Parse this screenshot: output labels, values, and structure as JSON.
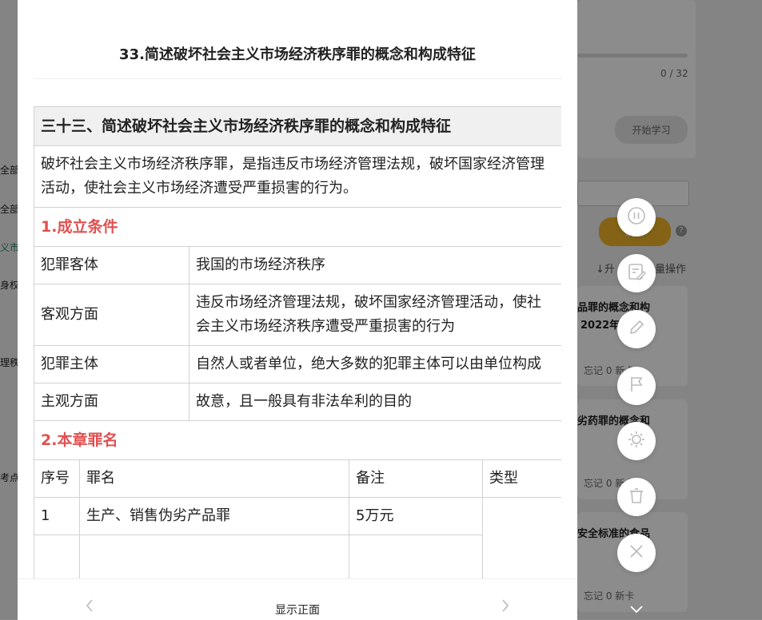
{
  "background": {
    "progress_count": "0 / 32",
    "start_button": "开始学习",
    "action_button": "刷新",
    "sort_hint": "升",
    "batch_label": "批量操作",
    "left_labels": [
      "全部",
      "全部",
      "义市",
      "身权",
      "理秩",
      "考点"
    ],
    "cards": [
      {
        "title": "品罪的概念和构",
        "subtitle": "2022年",
        "stats": "忘记 0  新卡"
      },
      {
        "title": "劣药罪的概念和",
        "stats": "忘记 0  新卡"
      },
      {
        "title": "安全标准的食品",
        "stats": "忘记 0  新卡"
      }
    ]
  },
  "modal": {
    "title": "33.简述破坏社会主义市场经济秩序罪的概念和构成特征",
    "card_heading": "三十三、简述破坏社会主义市场经济秩序罪的概念和构成特征",
    "definition": "破坏社会主义市场经济秩序罪，是指违反市场经济管理法规，破坏国家经济管理活动，使社会主义市场经济遭受严重损害的行为。",
    "section1_title": "1.成立条件",
    "conditions": [
      {
        "label": "犯罪客体",
        "value": "我国的市场经济秩序"
      },
      {
        "label": "客观方面",
        "value": "违反市场经济管理法规，破坏国家经济管理活动，使社会主义市场经济秩序遭受严重损害的行为"
      },
      {
        "label": "犯罪主体",
        "value": "自然人或者单位，绝大多数的犯罪主体可以由单位构成"
      },
      {
        "label": "主观方面",
        "value": "故意，且一般具有非法牟利的目的"
      }
    ],
    "section2_title": "2.本章罪名",
    "crime_table": {
      "headers": [
        "序号",
        "罪名",
        "备注",
        "类型"
      ],
      "rows": [
        {
          "no": "1",
          "name": "生产、销售伪劣产品罪",
          "note": "5万元",
          "type": ""
        }
      ]
    },
    "footer_label": "显示正面"
  },
  "fab_icons": [
    "pause-icon",
    "edit-note-icon",
    "pencil-icon",
    "flag-icon",
    "brightness-icon",
    "trash-icon",
    "close-icon"
  ],
  "colors": {
    "section_red": "#e05050",
    "accent_yellow": "#f0b429"
  }
}
